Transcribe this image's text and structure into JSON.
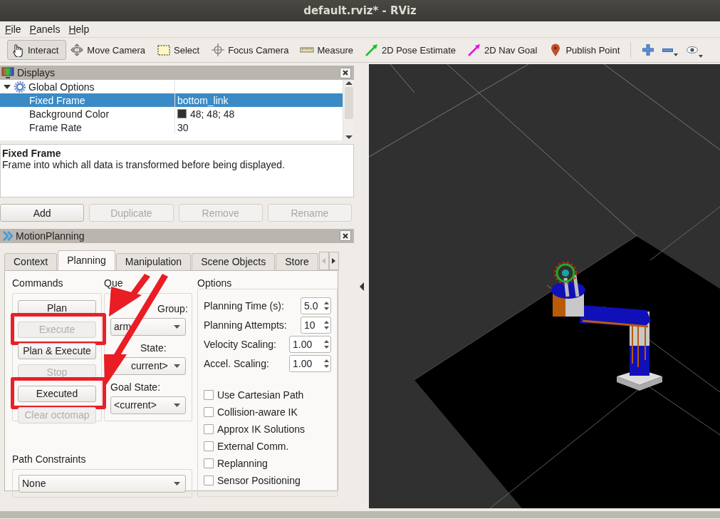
{
  "window": {
    "title": "default.rviz* - RViz"
  },
  "menu": [
    "File",
    "Panels",
    "Help"
  ],
  "toolbar": {
    "tools": [
      {
        "label": "Interact",
        "selected": true
      },
      {
        "label": "Move Camera",
        "selected": false
      },
      {
        "label": "Select",
        "selected": false
      },
      {
        "label": "Focus Camera",
        "selected": false
      },
      {
        "label": "Measure",
        "selected": false
      },
      {
        "label": "2D Pose Estimate",
        "selected": false
      },
      {
        "label": "2D Nav Goal",
        "selected": false
      },
      {
        "label": "Publish Point",
        "selected": false
      }
    ]
  },
  "displays_panel": {
    "title": "Displays",
    "tree": [
      {
        "label": "Global Options",
        "expanded": true,
        "selected": false,
        "children": [
          {
            "label": "Fixed Frame",
            "value": "bottom_link",
            "selected": true
          },
          {
            "label": "Background Color",
            "value": "48; 48; 48",
            "color": "#303030",
            "selected": false
          },
          {
            "label": "Frame Rate",
            "value": "30",
            "selected": false
          }
        ]
      }
    ],
    "description": {
      "title": "Fixed Frame",
      "text": "Frame into which all data is transformed before being displayed."
    },
    "buttons": [
      {
        "label": "Add",
        "disabled": false
      },
      {
        "label": "Duplicate",
        "disabled": true
      },
      {
        "label": "Remove",
        "disabled": true
      },
      {
        "label": "Rename",
        "disabled": true
      }
    ]
  },
  "motion_planning": {
    "title": "MotionPlanning",
    "tabs": [
      {
        "label": "Context",
        "selected": false
      },
      {
        "label": "Planning",
        "selected": true
      },
      {
        "label": "Manipulation",
        "selected": false
      },
      {
        "label": "Scene Objects",
        "selected": false
      },
      {
        "label": "Store",
        "selected": false
      }
    ],
    "commands": {
      "title": "Commands",
      "buttons": [
        {
          "label": "Plan",
          "disabled": false,
          "highlighted": false
        },
        {
          "label": "Execute",
          "disabled": true,
          "highlighted": true
        },
        {
          "label": "Plan & Execute",
          "disabled": false,
          "highlighted": false
        },
        {
          "label": "Stop",
          "disabled": true,
          "highlighted": false
        },
        {
          "label": "Executed",
          "disabled": false,
          "highlighted": true
        },
        {
          "label": "Clear octomap",
          "disabled": true,
          "highlighted": false
        }
      ]
    },
    "query": {
      "title": "Que",
      "fields": [
        {
          "label": "Group:",
          "value": "arm"
        },
        {
          "label": "State:",
          "value": "current>"
        },
        {
          "label": "Goal State:",
          "value": "<current>"
        }
      ]
    },
    "options": {
      "title": "Options",
      "spinners": [
        {
          "label": "Planning Time (s):",
          "value": "5.0"
        },
        {
          "label": "Planning Attempts:",
          "value": "10"
        },
        {
          "label": "Velocity Scaling:",
          "value": "1.00"
        },
        {
          "label": "Accel. Scaling:",
          "value": "1.00"
        }
      ],
      "checkboxes": [
        {
          "label": "Use Cartesian Path",
          "checked": false
        },
        {
          "label": "Collision-aware IK",
          "checked": false
        },
        {
          "label": "Approx IK Solutions",
          "checked": false
        },
        {
          "label": "External Comm.",
          "checked": false
        },
        {
          "label": "Replanning",
          "checked": false
        },
        {
          "label": "Sensor Positioning",
          "checked": false
        }
      ]
    },
    "path_constraints": {
      "label": "Path Constraints",
      "value": "None"
    }
  }
}
